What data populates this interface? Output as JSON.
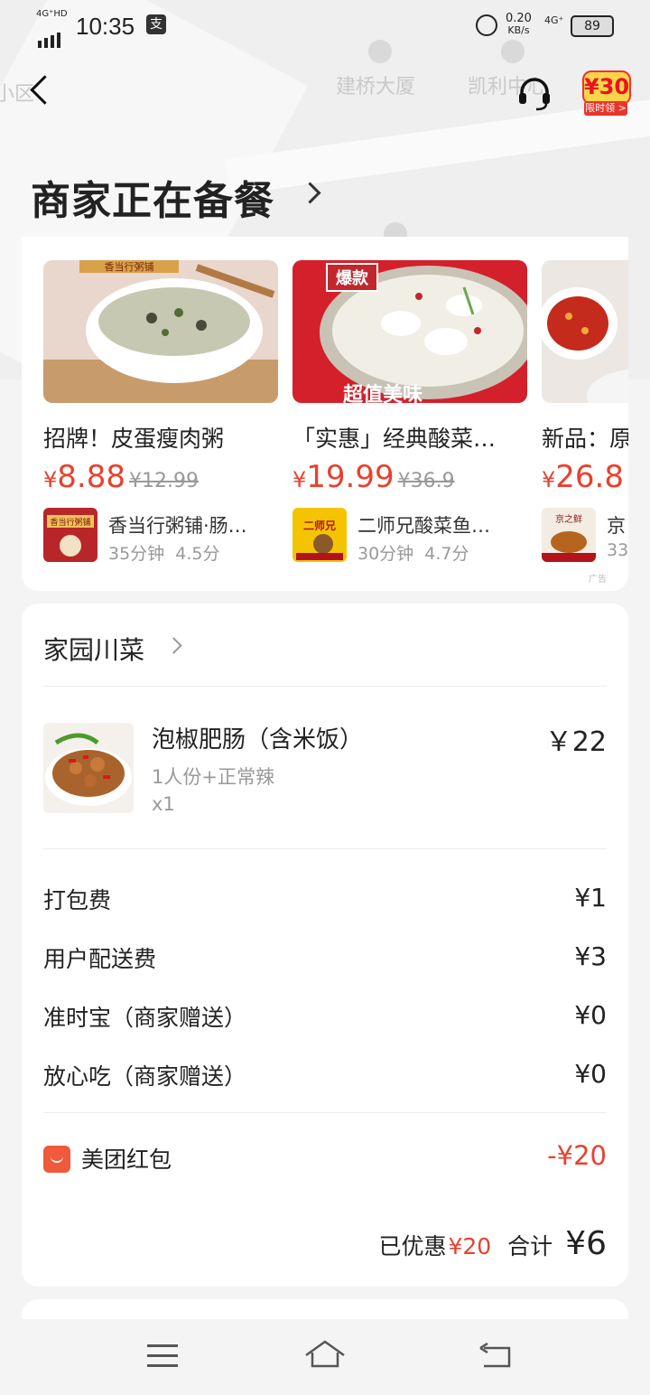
{
  "status_bar": {
    "network": "4G⁺HD",
    "time": "10:35",
    "pay_icon": "支",
    "speed_value": "0.20",
    "speed_unit": "KB/s",
    "network2": "4G⁺",
    "battery": "89"
  },
  "map": {
    "labels": [
      "建桥大厦",
      "凯利中心",
      "小区"
    ]
  },
  "topbar": {
    "back_icon": "chevron-left-icon",
    "service_icon": "headset-icon",
    "coupon_amount": "¥30",
    "coupon_tag": "限时领 >"
  },
  "order_status": {
    "title": "商家正在备餐"
  },
  "recommendations": {
    "ad_tag": "广告",
    "items": [
      {
        "name": "招牌！皮蛋瘦肉粥",
        "price": "8.88",
        "original_price": "¥12.99",
        "shop_name": "香当行粥铺·肠…",
        "time": "35分钟",
        "rating": "4.5分",
        "img_banner": "香当行粥铺",
        "logo_text": "香当行粥铺"
      },
      {
        "name": "「实惠」经典酸菜…",
        "price": "19.99",
        "original_price": "¥36.9",
        "shop_name": "二师兄酸菜鱼…",
        "time": "30分钟",
        "rating": "4.7分",
        "img_badge": "爆款",
        "img_banner": "超值美味",
        "logo_text": "二师兄"
      },
      {
        "name": "新品：原",
        "price": "26.8",
        "original_price": "",
        "shop_name": "京",
        "time": "33",
        "rating": "",
        "logo_text": "京之鲜"
      }
    ],
    "currency": "¥"
  },
  "order": {
    "shop_name": "家园川菜",
    "dish": {
      "name": "泡椒肥肠（含米饭）",
      "spec": "1人份+正常辣",
      "qty": "x1",
      "price": "￥22"
    },
    "fees": [
      {
        "label": "打包费",
        "value": "¥1"
      },
      {
        "label": "用户配送费",
        "value": "¥3"
      },
      {
        "label": "准时宝（商家赠送）",
        "value": "¥0"
      },
      {
        "label": "放心吃（商家赠送）",
        "value": "¥0"
      }
    ],
    "red_packet": {
      "label": "美团红包",
      "value": "-¥20"
    },
    "saved_label": "已优惠",
    "saved_value": "¥20",
    "total_label": "合计",
    "total_value": "¥6"
  },
  "navbar": {
    "menu_icon": "menu-icon",
    "home_icon": "home-icon",
    "back_icon": "back-icon"
  }
}
